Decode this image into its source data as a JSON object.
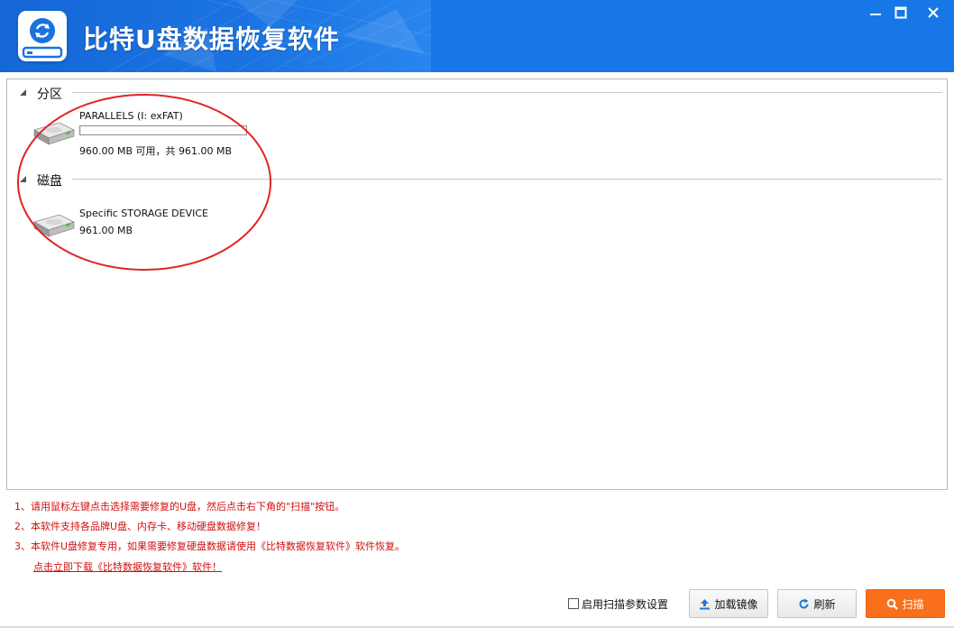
{
  "app": {
    "title": "比特U盘数据恢复软件"
  },
  "window_controls": {
    "minimize_icon": "minimize-icon",
    "maximize_icon": "maximize-icon",
    "close_icon": "close-icon"
  },
  "groups": {
    "partitions": {
      "label": "分区",
      "items": [
        {
          "name": "PARALLELS (I: exFAT)",
          "size_text": "960.00 MB 可用，共 961.00 MB",
          "used_fraction": 0.001
        }
      ]
    },
    "disks": {
      "label": "磁盘",
      "items": [
        {
          "name": "Specific STORAGE DEVICE",
          "size_text": "961.00 MB"
        }
      ]
    }
  },
  "tips": [
    "1、请用鼠标左键点击选择需要修复的U盘，然后点击右下角的\"扫描\"按钮。",
    "2、本软件支持各品牌U盘、内存卡、移动硬盘数据修复！",
    "3、本软件U盘修复专用，如果需要修复硬盘数据请使用《比特数据恢复软件》软件恢复。"
  ],
  "download_link": "点击立即下载《比特数据恢复软件》软件！",
  "controls": {
    "scan_params_label": "启用扫描参数设置",
    "scan_params_checked": false,
    "load_image_label": "加载镜像",
    "refresh_label": "刷新",
    "scan_label": "扫描"
  },
  "colors": {
    "title_bar": "#1877e6",
    "tip_text": "#d01010",
    "scan_button": "#fa6f1c",
    "annotation_ellipse": "#e02424"
  }
}
